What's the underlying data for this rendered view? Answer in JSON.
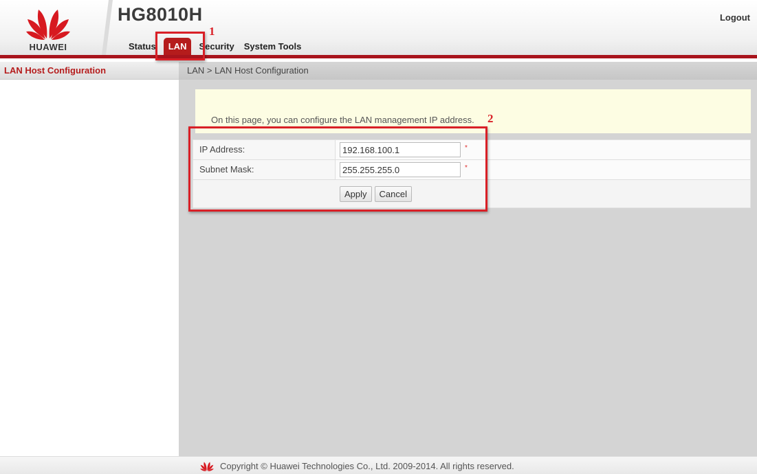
{
  "header": {
    "brand": "HUAWEI",
    "model": "HG8010H",
    "logout_label": "Logout",
    "nav": [
      {
        "label": "Status"
      },
      {
        "label": "LAN"
      },
      {
        "label": "Security"
      },
      {
        "label": "System Tools"
      }
    ],
    "active_nav": "LAN",
    "accent_color": "#a8141c"
  },
  "sidebar": {
    "title": "LAN Host Configuration"
  },
  "breadcrumb": "LAN > LAN Host Configuration",
  "info_text": "On this page, you can configure the LAN management IP address.",
  "form": {
    "ip_label": "IP Address:",
    "ip_value": "192.168.100.1",
    "mask_label": "Subnet Mask:",
    "mask_value": "255.255.255.0",
    "required_mark": "*",
    "apply_label": "Apply",
    "cancel_label": "Cancel"
  },
  "annotations": {
    "step1": "1",
    "step2": "2",
    "color": "#d91f26"
  },
  "footer": {
    "copyright": "Copyright © Huawei Technologies Co., Ltd. 2009-2014. All rights reserved."
  }
}
